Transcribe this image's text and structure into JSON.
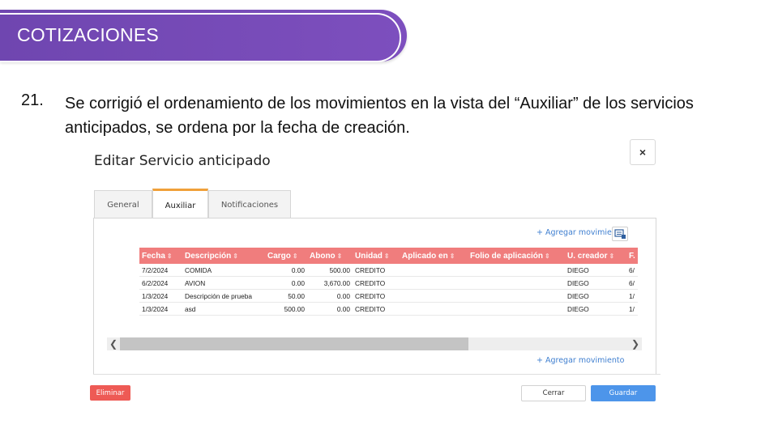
{
  "header": {
    "title": "COTIZACIONES"
  },
  "item": {
    "number": "21.",
    "text": "Se corrigió el ordenamiento de los movimientos en la vista del “Auxiliar” de los servicios anticipados, se ordena por la fecha de creación."
  },
  "dialog": {
    "title": "Editar Servicio anticipado",
    "close_label": "×",
    "tabs": [
      {
        "label": "General"
      },
      {
        "label": "Auxiliar"
      },
      {
        "label": "Notificaciones"
      }
    ],
    "active_tab": "Auxiliar",
    "add_movement_label": "+ Agregar movimiento",
    "add_movement_label_top": "+ Agregar movimiento",
    "columns": [
      "Fecha",
      "Descripción",
      "Cargo",
      "Abono",
      "Unidad",
      "Aplicado en",
      "Folio de aplicación",
      "U. creador",
      "F."
    ],
    "rows": [
      {
        "fecha": "7/2/2024",
        "descripcion": "COMIDA",
        "cargo": "0.00",
        "abono": "500.00",
        "unidad": "CREDITO",
        "aplicado": "",
        "folio": "",
        "creador": "DIEGO",
        "f": "6/"
      },
      {
        "fecha": "6/2/2024",
        "descripcion": "AVION",
        "cargo": "0.00",
        "abono": "3,670.00",
        "unidad": "CREDITO",
        "aplicado": "",
        "folio": "",
        "creador": "DIEGO",
        "f": "6/"
      },
      {
        "fecha": "1/3/2024",
        "descripcion": "Descripción de prueba",
        "cargo": "50.00",
        "abono": "0.00",
        "unidad": "CREDITO",
        "aplicado": "",
        "folio": "",
        "creador": "DIEGO",
        "f": "1/"
      },
      {
        "fecha": "1/3/2024",
        "descripcion": "asd",
        "cargo": "500.00",
        "abono": "0.00",
        "unidad": "CREDITO",
        "aplicado": "",
        "folio": "",
        "creador": "DIEGO",
        "f": "1/"
      }
    ],
    "buttons": {
      "delete": "Eliminar",
      "close": "Cerrar",
      "save": "Guardar"
    },
    "colors": {
      "header_row": "#f07d7d",
      "save": "#4d95ea",
      "delete": "#ee5a55",
      "banner": "#7048b3",
      "active_tab_accent": "#f0a03a"
    },
    "icons": {
      "sort": "sort-icon",
      "add": "add-movement-icon",
      "close": "close-icon"
    }
  }
}
